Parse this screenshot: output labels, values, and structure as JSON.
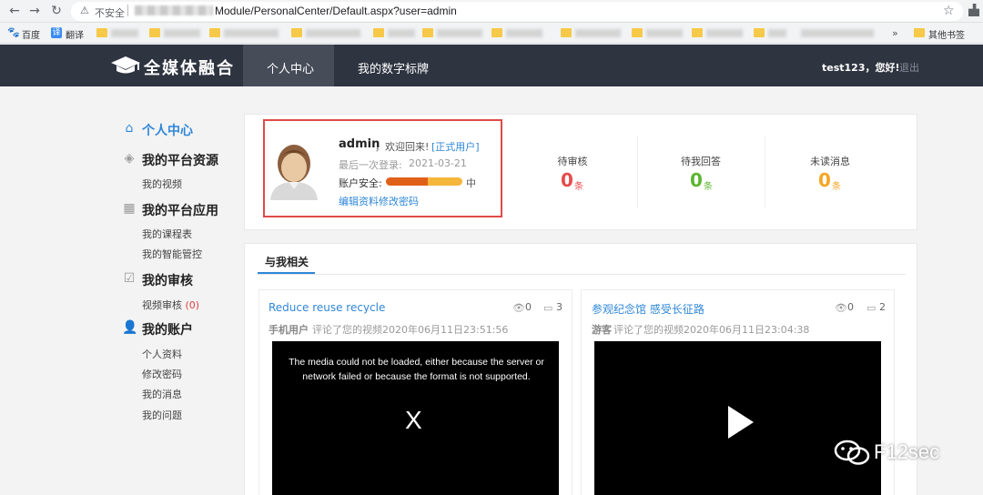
{
  "browser": {
    "insecure_label": "不安全",
    "url_path": "Module/PersonalCenter/Default.aspx?user=admin",
    "bookmarks": {
      "baidu": "百度",
      "fanyi": "翻译",
      "more": "»",
      "other": "其他书签"
    }
  },
  "header": {
    "logo": "全媒体融合",
    "nav": [
      "个人中心",
      "我的数字标牌"
    ],
    "greeting": "test123，您好!",
    "logout": "退出"
  },
  "sidebar": {
    "personal_center": "个人中心",
    "groups": [
      {
        "title": "我的平台资源",
        "items": [
          "我的视频"
        ]
      },
      {
        "title": "我的平台应用",
        "items": [
          "我的课程表",
          "我的智能管控"
        ]
      },
      {
        "title": "我的审核",
        "items": [
          "视频审核"
        ]
      },
      {
        "title": "我的账户",
        "items": [
          "个人资料",
          "修改密码",
          "我的消息",
          "我的问题"
        ]
      }
    ],
    "review_count": "(0)"
  },
  "profile": {
    "username": "admin",
    "welcome": "，欢迎回来!",
    "role": "[正式用户]",
    "last_login_label": "最后一次登录:",
    "last_login_date": "2021-03-21",
    "security_label": "账户安全:",
    "security_level": "中",
    "security_fraction": 0.55,
    "edit_profile": "编辑资料",
    "change_password": "修改密码"
  },
  "stats": [
    {
      "label": "待审核",
      "value": "0",
      "unit": "条",
      "color": "#e84a4a"
    },
    {
      "label": "待我回答",
      "value": "0",
      "unit": "条",
      "color": "#5cb531"
    },
    {
      "label": "未读消息",
      "value": "0",
      "unit": "条",
      "color": "#f5a623"
    }
  ],
  "related": {
    "tab": "与我相关",
    "cards": [
      {
        "title": "Reduce reuse recycle",
        "views": "0",
        "comments": "3",
        "user": "手机用户",
        "meta": "评论了您的视频2020年06月11日23:51:56",
        "video_error": "The media could not be loaded, either because the server or network failed or because the format is not supported.",
        "video_x": "X"
      },
      {
        "title": "参观纪念馆 感受长征路",
        "views": "0",
        "comments": "2",
        "user": "游客",
        "meta": "评论了您的视频2020年06月11日23:04:38"
      }
    ]
  },
  "watermark": "F12sec"
}
